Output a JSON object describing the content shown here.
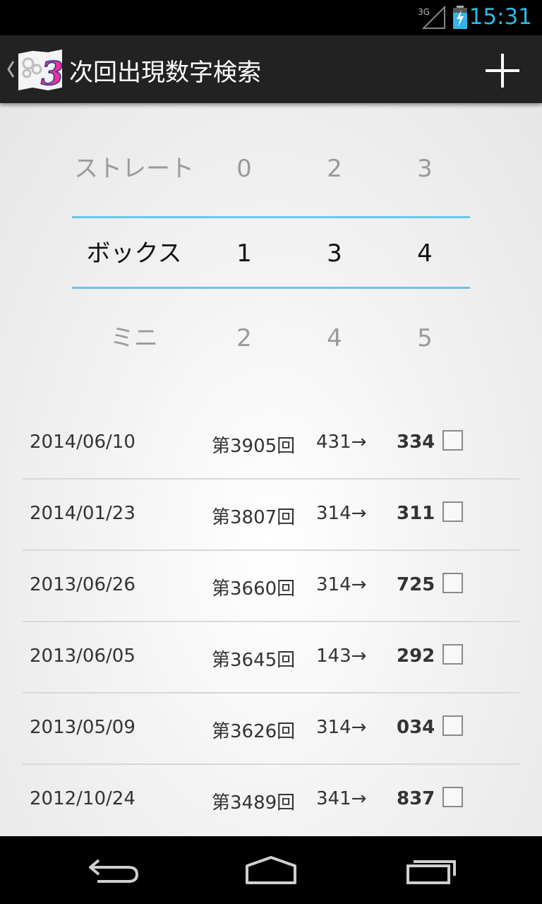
{
  "status_bar": {
    "network": "3G",
    "time": "15:31",
    "accent_color": "#33b5e5"
  },
  "action_bar": {
    "title": "次回出現数字検索",
    "logo_numeral": "3",
    "logo_color": "#e8339b",
    "add_icon": "plus-icon"
  },
  "picker": {
    "rows": [
      {
        "label": "ストレート",
        "digits": [
          "0",
          "2",
          "3"
        ]
      },
      {
        "label": "ボックス",
        "digits": [
          "1",
          "3",
          "4"
        ]
      },
      {
        "label": "ミニ",
        "digits": [
          "2",
          "4",
          "5"
        ]
      }
    ],
    "selected_row": 1,
    "selection_line_color": "#6cc4ea"
  },
  "results": [
    {
      "date": "2014/06/10",
      "round": "第3905回",
      "prev": "431→",
      "next": "334",
      "checked": false
    },
    {
      "date": "2014/01/23",
      "round": "第3807回",
      "prev": "314→",
      "next": "311",
      "checked": false
    },
    {
      "date": "2013/06/26",
      "round": "第3660回",
      "prev": "314→",
      "next": "725",
      "checked": false
    },
    {
      "date": "2013/06/05",
      "round": "第3645回",
      "prev": "143→",
      "next": "292",
      "checked": false
    },
    {
      "date": "2013/05/09",
      "round": "第3626回",
      "prev": "314→",
      "next": "034",
      "checked": false
    },
    {
      "date": "2012/10/24",
      "round": "第3489回",
      "prev": "341→",
      "next": "837",
      "checked": false
    }
  ],
  "nav_bar": {
    "icons": [
      "back-icon",
      "home-icon",
      "recent-apps-icon"
    ]
  }
}
